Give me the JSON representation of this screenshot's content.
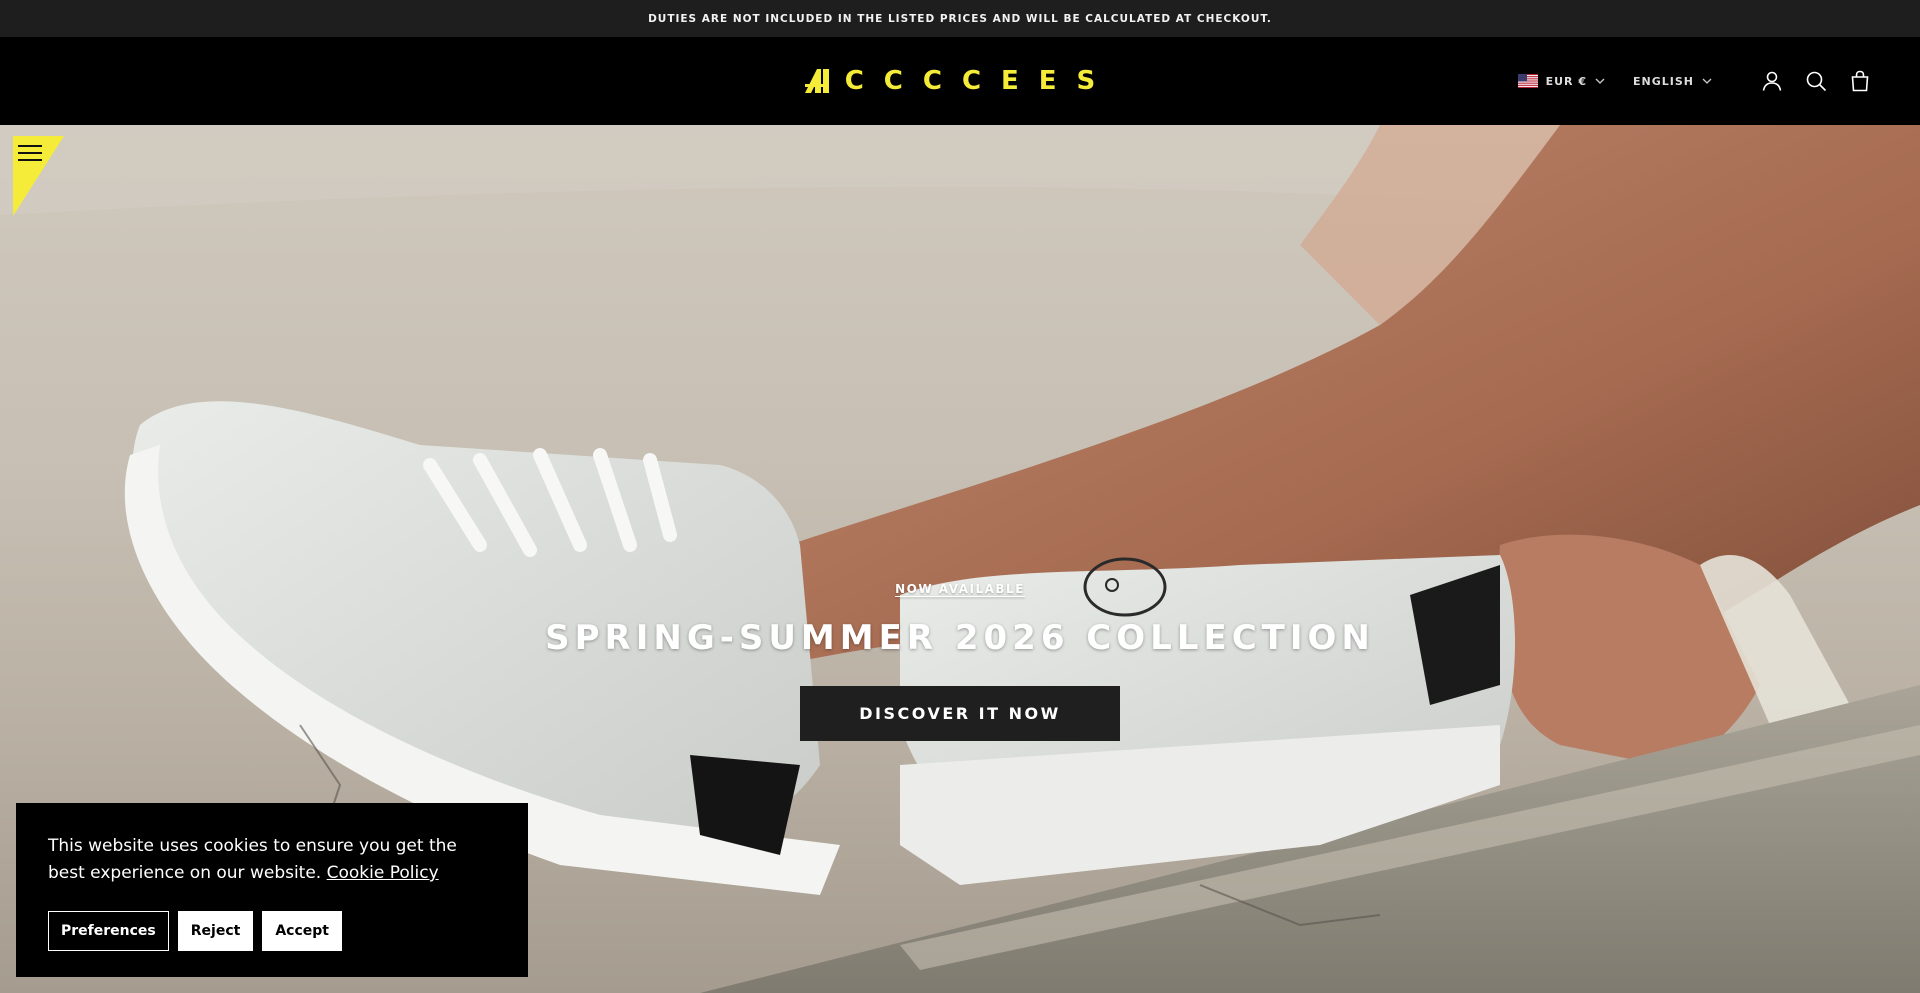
{
  "announcement": {
    "text": "DUTIES ARE NOT INCLUDED IN THE LISTED PRICES AND WILL BE CALCULATED AT CHECKOUT."
  },
  "header": {
    "logo_text": "CCCCEES",
    "currency": {
      "label": "EUR €",
      "flag": "us-flag-icon"
    },
    "language": {
      "label": "ENGLISH"
    },
    "icons": [
      "account-icon",
      "search-icon",
      "cart-icon"
    ]
  },
  "hero": {
    "eyebrow": "NOW AVAILABLE",
    "title": "SPRING-SUMMER 2026 COLLECTION",
    "cta_label": "DISCOVER IT NOW"
  },
  "cookie_banner": {
    "text": "This website uses cookies to ensure you get the best experience on our website.",
    "link_label": "Cookie Policy",
    "buttons": {
      "preferences": "Preferences",
      "reject": "Reject",
      "accept": "Accept"
    }
  },
  "colors": {
    "brand_yellow": "#f5ec3a",
    "header_bg": "#000000",
    "announcement_bg": "#1e1e1e"
  }
}
